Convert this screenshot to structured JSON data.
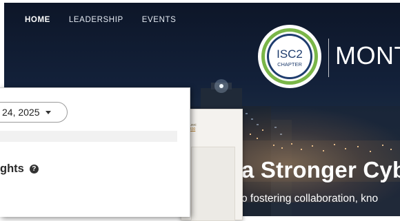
{
  "nav": {
    "items": [
      {
        "label": "HOME",
        "active": true
      },
      {
        "label": "LEADERSHIP",
        "active": false
      },
      {
        "label": "EVENTS",
        "active": false
      }
    ]
  },
  "logo": {
    "line1": "ISC2",
    "line2": "CHAPTER",
    "brand_text": "MONT",
    "ring_color": "#7ab648",
    "inner_color": "#1f3d6e"
  },
  "hero": {
    "headline": "a Stronger Cyb",
    "subline": "o fostering collaboration, kno"
  },
  "popup": {
    "date_label": "24, 2025",
    "section_title": "ghts",
    "help_icon": "help-circle-icon"
  },
  "background_doc": {
    "tiny_text_1": "unni",
    "tiny_text_2": "430"
  }
}
